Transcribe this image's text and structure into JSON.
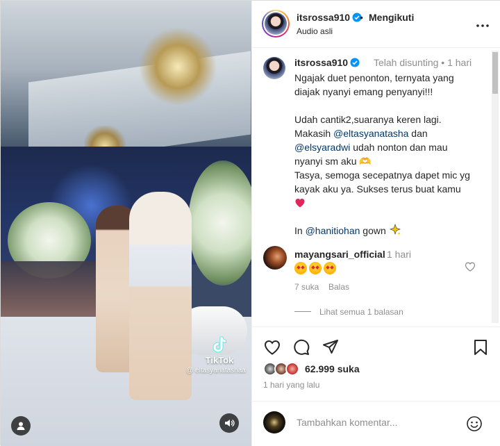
{
  "header": {
    "username": "itsrossa910",
    "separator": "•",
    "follow_status": "Mengikuti",
    "audio": "Audio asli"
  },
  "caption": {
    "username": "itsrossa910",
    "edited": "Telah disunting",
    "separator": "•",
    "time": "1 hari",
    "line1": "Ngajak duet penonton, ternyata yang",
    "line2": "diajak nyanyi emang penyanyi!!!",
    "line3": "Udah cantik2,suaranya keren lagi.",
    "line4_prefix": "Makasih ",
    "mention1": "@eltasyanatasha",
    "line4_suffix": " dan",
    "mention2": "@elsyaradwi",
    "line5_suffix": " udah nonton dan mau",
    "line6": "nyanyi sm aku 🫶",
    "line7": "Tasya, semoga secepatnya dapet mic yg",
    "line8": "kayak aku ya. Sukses terus buat kamu",
    "line9_prefix": "In ",
    "mention3": "@hanitiohan",
    "line9_suffix": " gown"
  },
  "comment": {
    "username": "mayangsari_official",
    "time": "1 hari",
    "likes": "7 suka",
    "reply": "Balas",
    "view_replies": "Lihat semua 1 balasan"
  },
  "post": {
    "likes": "62.999 suka",
    "date": "1 hari yang lalu"
  },
  "add_comment": {
    "placeholder": "Tambahkan komentar..."
  },
  "media": {
    "watermark_brand": "TikTok",
    "watermark_handle": "@ eltasyanatashaa"
  },
  "icons": {
    "verified": "verified-badge-icon",
    "more": "more-options-icon",
    "like": "heart-icon",
    "comment": "comment-icon",
    "share": "send-icon",
    "save": "bookmark-icon",
    "emoji": "emoji-icon",
    "user_tags": "user-tag-icon",
    "audio": "speaker-icon"
  },
  "colors": {
    "verified": "#0095f6",
    "link": "#00376b",
    "secondary_text": "#8e8e8e"
  }
}
